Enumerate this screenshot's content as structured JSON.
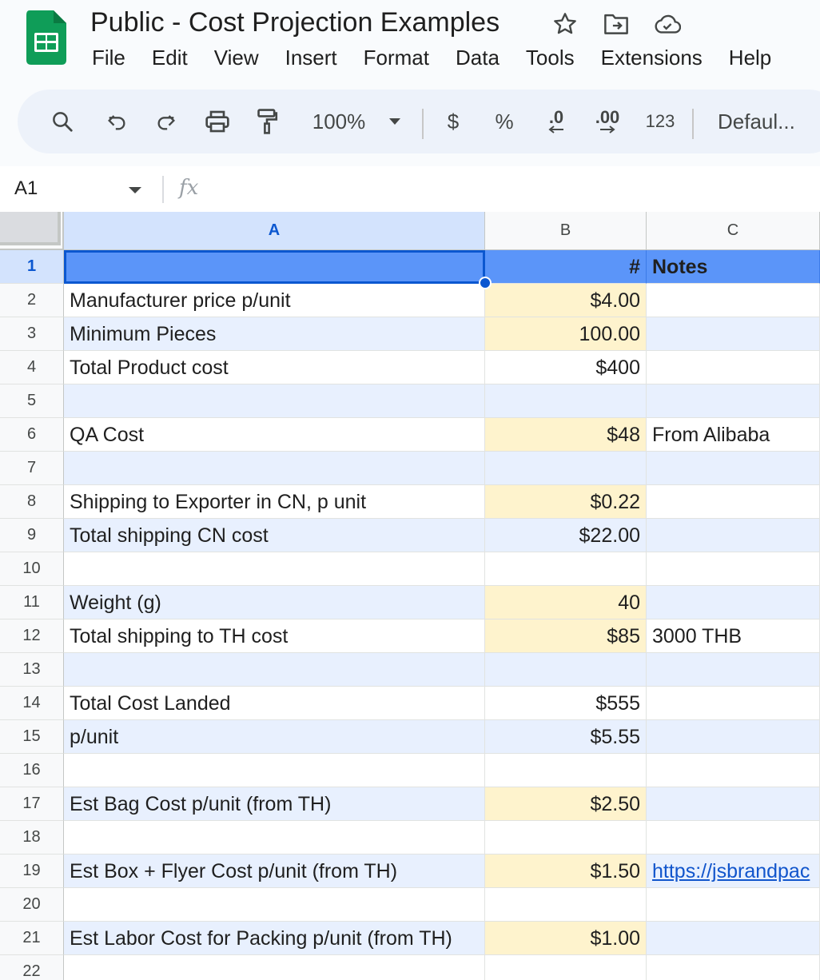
{
  "app": {
    "doc_title": "Public - Cost Projection Examples",
    "menu": [
      "File",
      "Edit",
      "View",
      "Insert",
      "Format",
      "Data",
      "Tools",
      "Extensions",
      "Help"
    ]
  },
  "toolbar": {
    "zoom": "100%",
    "currency": "$",
    "percent": "%",
    "decrease_decimal": ".0",
    "increase_decimal": ".00",
    "number_format": "123",
    "font": "Defaul..."
  },
  "formula_bar": {
    "name_box": "A1",
    "fx": "fx"
  },
  "grid": {
    "columns": [
      "A",
      "B",
      "C"
    ],
    "selected_column": "A",
    "rows": [
      {
        "n": "1",
        "a": "",
        "b": "#",
        "c": "Notes",
        "style": "header"
      },
      {
        "n": "2",
        "a": "Manufacturer price p/unit",
        "b": "$4.00",
        "c": "",
        "input": true,
        "band": false
      },
      {
        "n": "3",
        "a": "Minimum Pieces",
        "b": "100.00",
        "c": "",
        "input": true,
        "band": true
      },
      {
        "n": "4",
        "a": "Total Product cost",
        "b": "$400",
        "c": "",
        "input": false,
        "band": false
      },
      {
        "n": "5",
        "a": "",
        "b": "",
        "c": "",
        "input": false,
        "band": true
      },
      {
        "n": "6",
        "a": "QA Cost",
        "b": "$48",
        "c": "From Alibaba",
        "input": true,
        "band": false
      },
      {
        "n": "7",
        "a": "",
        "b": "",
        "c": "",
        "input": false,
        "band": true
      },
      {
        "n": "8",
        "a": "Shipping to Exporter in CN, p unit",
        "b": "$0.22",
        "c": "",
        "input": true,
        "band": false
      },
      {
        "n": "9",
        "a": "Total shipping CN cost",
        "b": "$22.00",
        "c": "",
        "input": false,
        "band": true
      },
      {
        "n": "10",
        "a": "",
        "b": "",
        "c": "",
        "input": false,
        "band": false
      },
      {
        "n": "11",
        "a": "Weight (g)",
        "b": "40",
        "c": "",
        "input": true,
        "band": true
      },
      {
        "n": "12",
        "a": "Total shipping to TH cost",
        "b": "$85",
        "c": "3000 THB",
        "input": true,
        "band": false
      },
      {
        "n": "13",
        "a": "",
        "b": "",
        "c": "",
        "input": false,
        "band": true
      },
      {
        "n": "14",
        "a": "Total Cost Landed",
        "b": "$555",
        "c": "",
        "input": false,
        "band": false
      },
      {
        "n": "15",
        "a": "p/unit",
        "b": "$5.55",
        "c": "",
        "input": false,
        "band": true
      },
      {
        "n": "16",
        "a": "",
        "b": "",
        "c": "",
        "input": false,
        "band": false
      },
      {
        "n": "17",
        "a": "Est Bag Cost p/unit (from TH)",
        "b": "$2.50",
        "c": "",
        "input": true,
        "band": true
      },
      {
        "n": "18",
        "a": "",
        "b": "",
        "c": "",
        "input": false,
        "band": false
      },
      {
        "n": "19",
        "a": "Est Box + Flyer Cost p/unit (from TH)",
        "b": "$1.50",
        "c": "https://jsbrandpac",
        "link": true,
        "input": true,
        "band": true
      },
      {
        "n": "20",
        "a": "",
        "b": "",
        "c": "",
        "input": false,
        "band": false
      },
      {
        "n": "21",
        "a": "Est Labor Cost for Packing p/unit (from TH)",
        "b": "$1.00",
        "c": "",
        "input": true,
        "band": true
      },
      {
        "n": "22",
        "a": "",
        "b": "",
        "c": "",
        "input": false,
        "band": false
      }
    ]
  },
  "colors": {
    "header_fill": "#5b95f9",
    "band_fill": "#e8f0fe",
    "input_fill": "#fef3cd",
    "selection": "#0b57d0"
  }
}
